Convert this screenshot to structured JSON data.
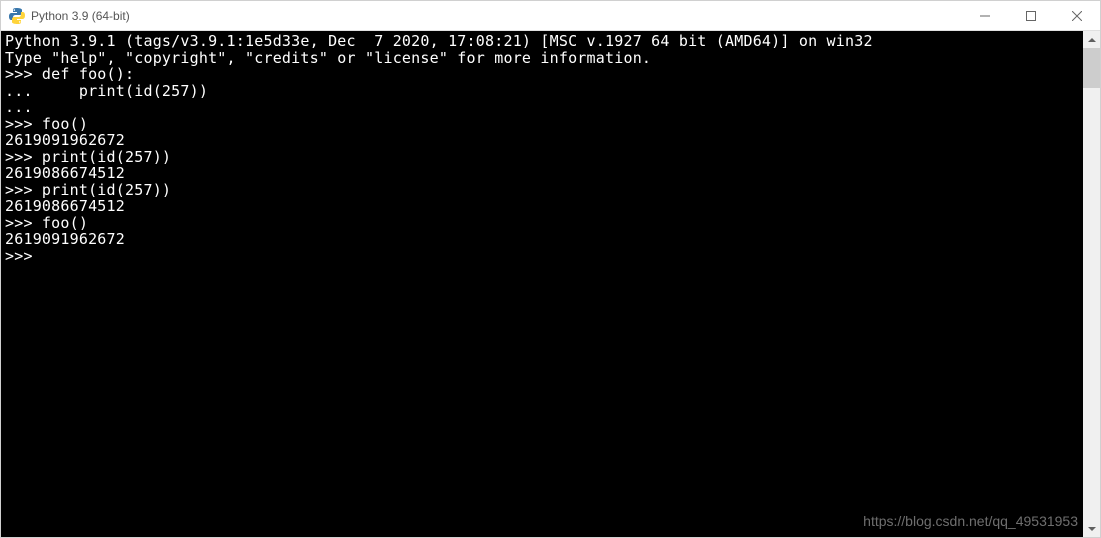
{
  "window": {
    "title": "Python 3.9 (64-bit)"
  },
  "terminal": {
    "lines": [
      "Python 3.9.1 (tags/v3.9.1:1e5d33e, Dec  7 2020, 17:08:21) [MSC v.1927 64 bit (AMD64)] on win32",
      "Type \"help\", \"copyright\", \"credits\" or \"license\" for more information.",
      ">>> def foo():",
      "...     print(id(257))",
      "...",
      ">>> foo()",
      "2619091962672",
      ">>> print(id(257))",
      "2619086674512",
      ">>> print(id(257))",
      "2619086674512",
      ">>> foo()",
      "2619091962672",
      ">>> "
    ]
  },
  "watermark": "https://blog.csdn.net/qq_49531953"
}
